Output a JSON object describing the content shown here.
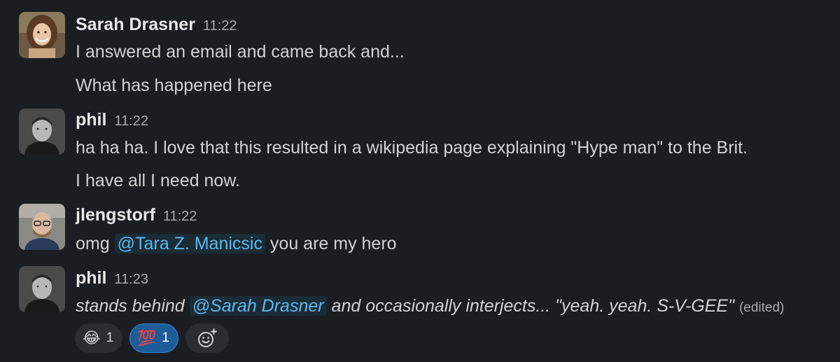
{
  "colors": {
    "background": "#1a1d21",
    "text": "#d1d2d3",
    "mention": "#5cb8f1",
    "reaction_active": "#1d5c99"
  },
  "messages": [
    {
      "author": "Sarah Drasner",
      "time": "11:22",
      "lines": [
        "I answered an email and came back and...",
        "What has happened here"
      ]
    },
    {
      "author": "phil",
      "time": "11:22",
      "lines": [
        "ha ha ha. I love that this resulted in a wikipedia page explaining \"Hype man\" to the Brit.",
        "I have all I need now."
      ]
    },
    {
      "author": "jlengstorf",
      "time": "11:22",
      "pre": "omg",
      "mention": "@Tara Z. Manicsic",
      "post": "you are my hero"
    },
    {
      "author": "phil",
      "time": "11:23",
      "pre": "stands behind",
      "mention": "@Sarah Drasner",
      "post": "and occasionally interjects... \"yeah. yeah. S-V-GEE\"",
      "edited": "(edited)"
    }
  ],
  "reactions": [
    {
      "emoji": "😂",
      "icon": "joy-emoji",
      "count": "1"
    },
    {
      "emoji": "💯",
      "icon": "hundred-points-emoji",
      "count": "1"
    }
  ],
  "add_reaction_icon": "add-reaction-icon"
}
